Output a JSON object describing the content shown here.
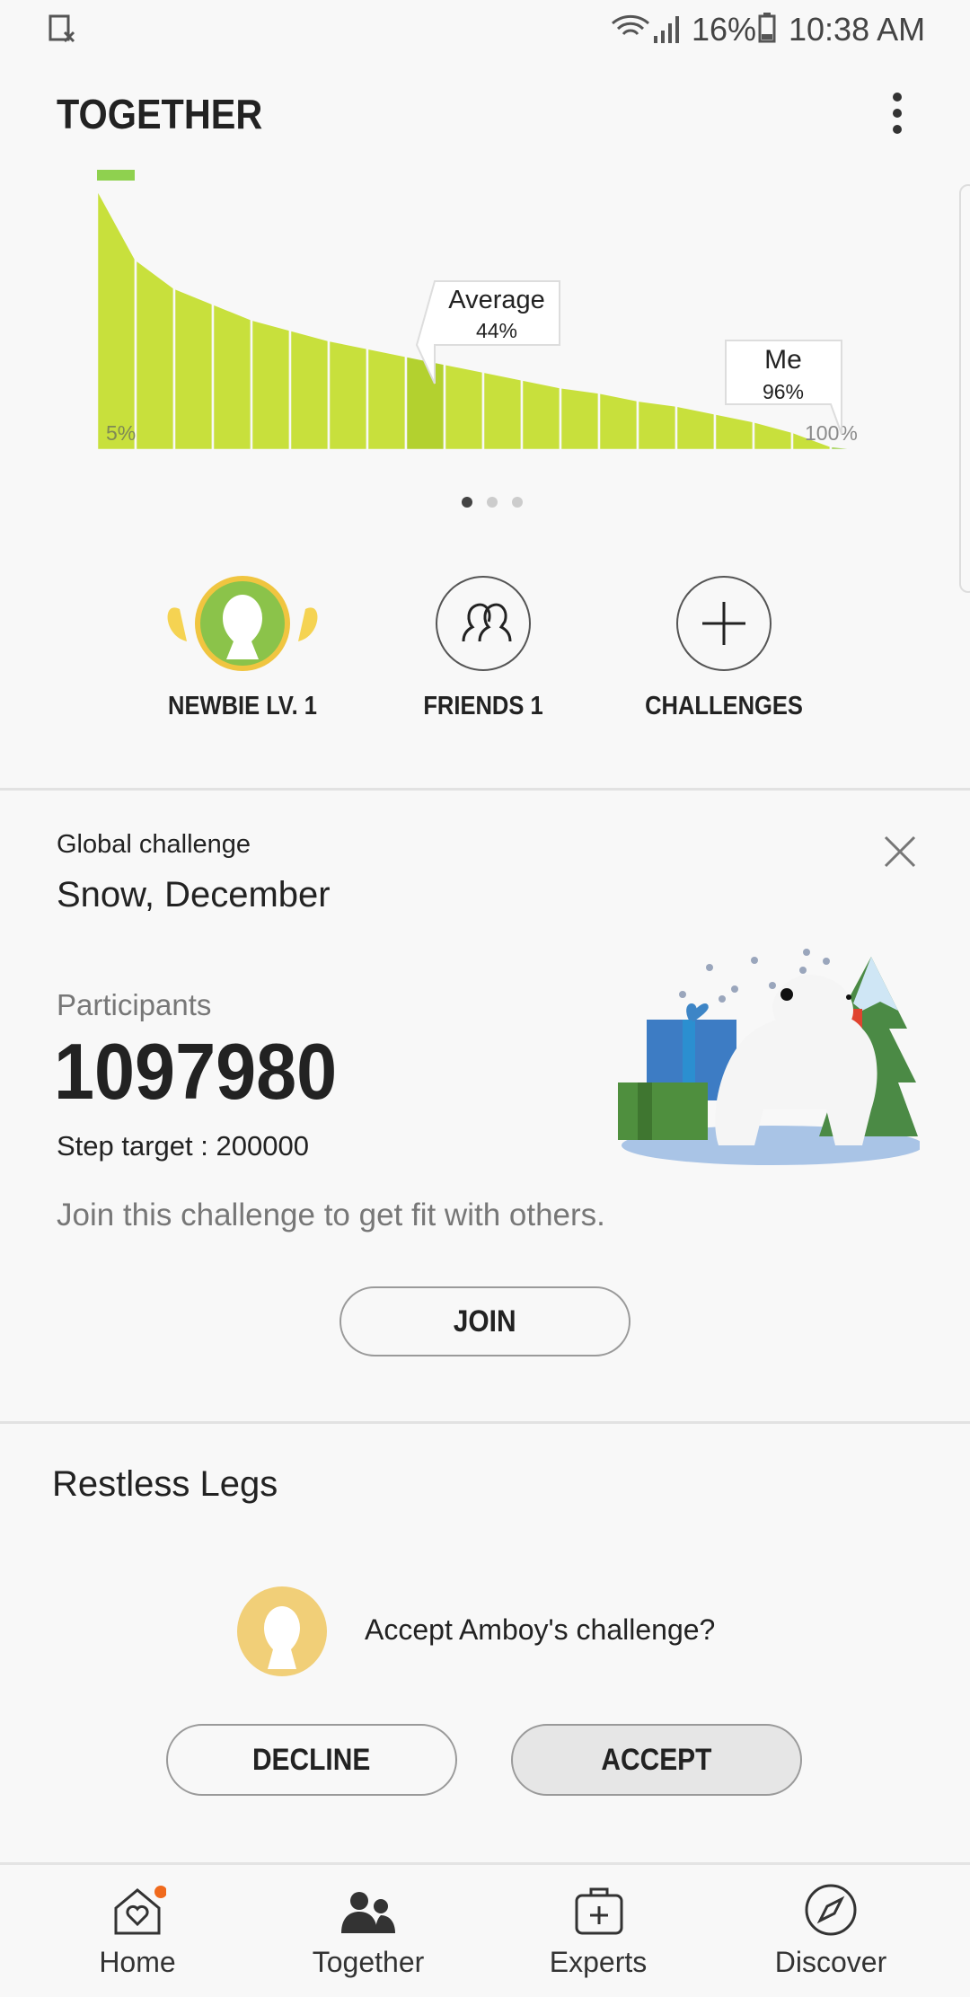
{
  "status_bar": {
    "battery": "16%",
    "time": "10:38 AM"
  },
  "header": {
    "title": "TOGETHER",
    "menu_icon": "more-vertical-icon"
  },
  "chart_data": {
    "type": "area",
    "description_labels": {
      "min_label": "5%",
      "max_label": "100%"
    },
    "relative_heights": [
      100,
      73,
      62,
      56,
      50,
      46,
      42,
      39,
      36,
      33,
      30,
      27,
      24,
      22,
      19,
      17,
      14,
      11,
      7,
      1.5,
      0
    ],
    "highlight_column": 8,
    "markers": [
      {
        "label": "Average",
        "value": "44%"
      },
      {
        "label": "Me",
        "value": "96%"
      }
    ],
    "colors": {
      "fill": "#c8e03c",
      "highlight": "#b3d12f",
      "top": "#8fd14f"
    }
  },
  "pager": {
    "count": 3,
    "active": 0
  },
  "shortcuts": [
    {
      "label": "NEWBIE LV. 1",
      "icon": "level-avatar-icon"
    },
    {
      "label": "FRIENDS 1",
      "icon": "friends-icon"
    },
    {
      "label": "CHALLENGES",
      "icon": "plus-icon"
    }
  ],
  "global_challenge": {
    "kicker": "Global challenge",
    "name": "Snow, December",
    "participants_label": "Participants",
    "participants": "1097980",
    "step_target": "Step target : 200000",
    "description": "Join this challenge to get fit with others.",
    "join_label": "JOIN"
  },
  "invite": {
    "title": "Restless Legs",
    "message": "Accept Amboy's challenge?",
    "decline_label": "DECLINE",
    "accept_label": "ACCEPT"
  },
  "nav": [
    {
      "label": "Home",
      "icon": "home-heart-icon",
      "badge": true
    },
    {
      "label": "Together",
      "icon": "people-icon"
    },
    {
      "label": "Experts",
      "icon": "medical-bag-icon"
    },
    {
      "label": "Discover",
      "icon": "compass-icon"
    }
  ]
}
